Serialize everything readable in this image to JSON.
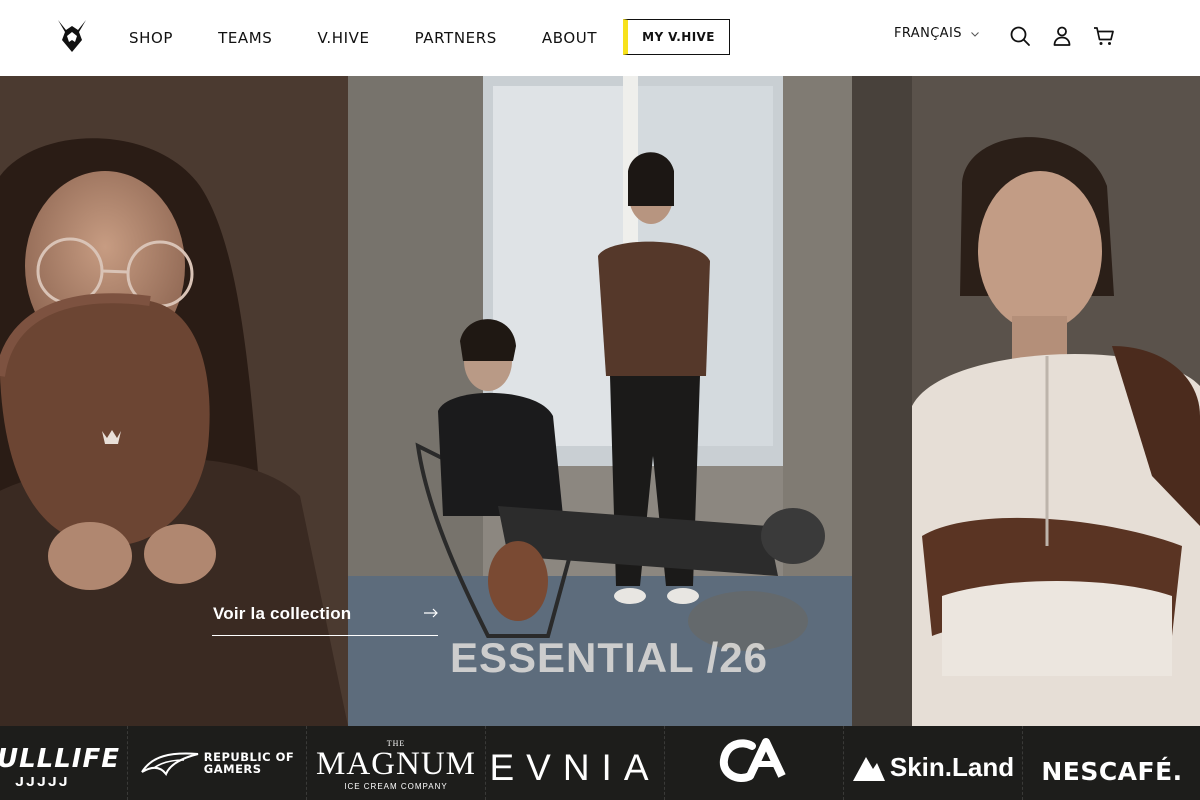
{
  "header": {
    "nav": [
      "SHOP",
      "TEAMS",
      "V.HIVE",
      "PARTNERS",
      "ABOUT"
    ],
    "my_vhive": "MY V.HIVE",
    "language": "FRANÇAIS",
    "icons": [
      "search-icon",
      "account-icon",
      "cart-icon"
    ]
  },
  "hero": {
    "cta_label": "Voir la collection",
    "collection_title": "ESSENTIAL /26"
  },
  "partners": [
    {
      "name": "Bullfrog Full Life",
      "text": "ULLLIFE",
      "subtext": "ᒍᒍᒍᒍᒍ"
    },
    {
      "name": "Republic of Gamers",
      "text": "REPUBLIC OF",
      "subtext": "GAMERS"
    },
    {
      "name": "The Magnum",
      "text": "MAGNUM",
      "pretext": "THE",
      "subtext": "ICE CREAM COMPANY"
    },
    {
      "name": "EVNIA",
      "text": "EVNIA"
    },
    {
      "name": "Crédit Agricole",
      "text": "CA"
    },
    {
      "name": "Skin.Land",
      "text": "Skin.Land"
    },
    {
      "name": "Nescafé",
      "text": "NESCAFÉ."
    }
  ],
  "colors": {
    "accent_yellow": "#f7e21c",
    "partners_bg": "#1d1d1b",
    "text": "#111111"
  }
}
